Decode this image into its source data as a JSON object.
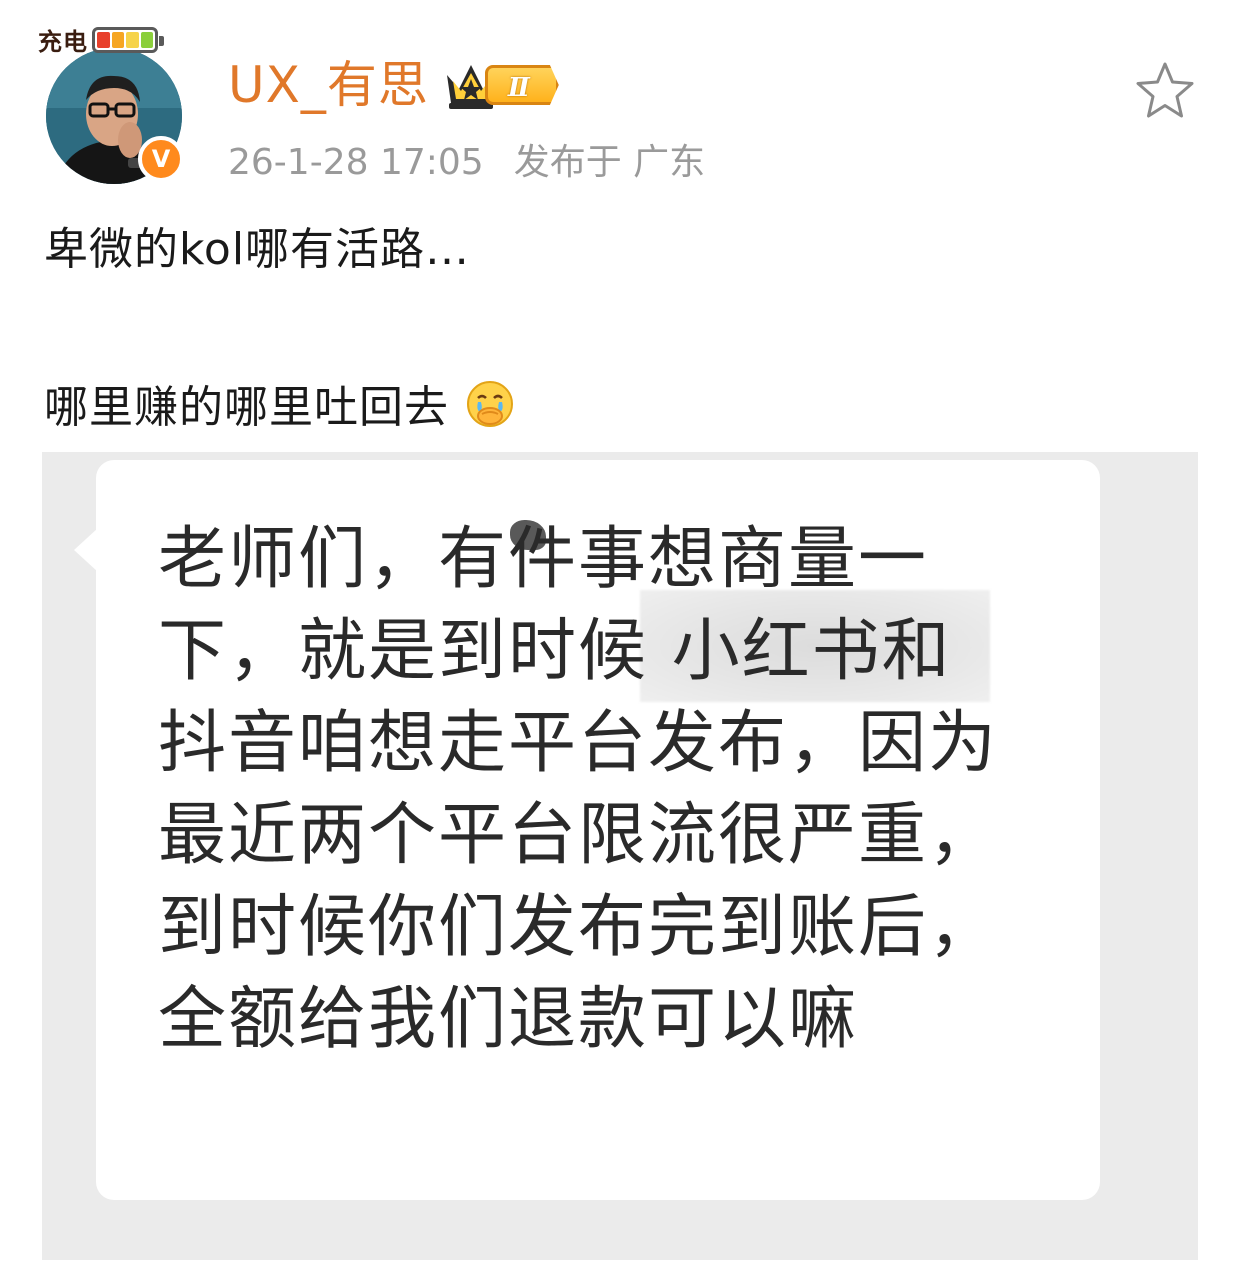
{
  "status": {
    "charging_label": "充电",
    "battery_colors": [
      "#e8402b",
      "#f6a623",
      "#f6d34a",
      "#8bcf3b"
    ]
  },
  "post": {
    "username": "UX_有思",
    "level_badge": "Ⅱ",
    "timestamp": "26-1-28 17:05",
    "location": "发布于 广东",
    "text_line_1": "卑微的kol哪有活路…",
    "text_line_2": "哪里赚的哪里吐回去",
    "emoji": "crying-covering-mouth-emoji",
    "favorite_icon": "star-outline-icon",
    "verified_mark": "V"
  },
  "image": {
    "message": "老师们，有件事想商量一下，就是到时候 小红书和抖音咱想走平台发布，因为最近两个平台限流很严重，到时候你们发布完到账后，全额给我们退款可以嘛"
  },
  "colors": {
    "username": "#e0782a",
    "meta_text": "#9a9a9a",
    "verify_badge": "#ff8a1d",
    "image_bg": "#ebebeb"
  }
}
